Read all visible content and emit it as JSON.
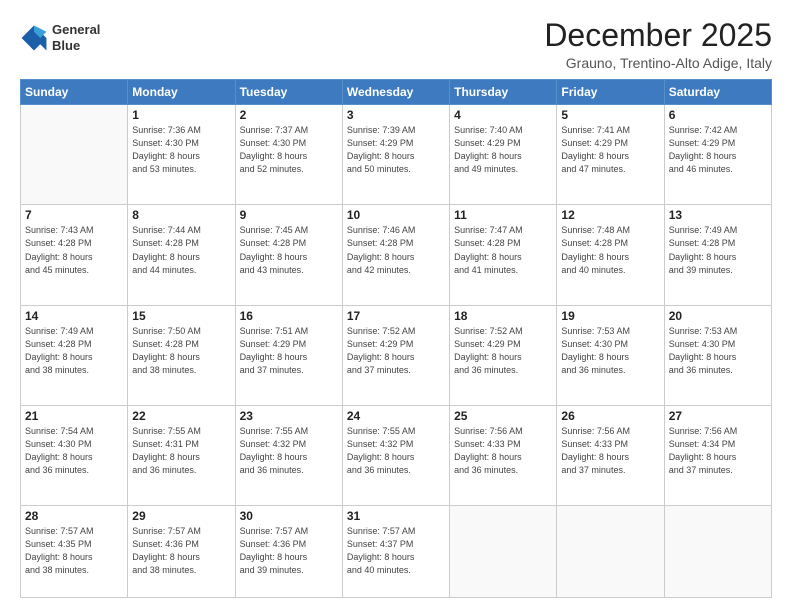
{
  "header": {
    "logo_line1": "General",
    "logo_line2": "Blue",
    "month": "December 2025",
    "location": "Grauno, Trentino-Alto Adige, Italy"
  },
  "weekdays": [
    "Sunday",
    "Monday",
    "Tuesday",
    "Wednesday",
    "Thursday",
    "Friday",
    "Saturday"
  ],
  "weeks": [
    [
      {
        "day": "",
        "info": ""
      },
      {
        "day": "1",
        "info": "Sunrise: 7:36 AM\nSunset: 4:30 PM\nDaylight: 8 hours\nand 53 minutes."
      },
      {
        "day": "2",
        "info": "Sunrise: 7:37 AM\nSunset: 4:30 PM\nDaylight: 8 hours\nand 52 minutes."
      },
      {
        "day": "3",
        "info": "Sunrise: 7:39 AM\nSunset: 4:29 PM\nDaylight: 8 hours\nand 50 minutes."
      },
      {
        "day": "4",
        "info": "Sunrise: 7:40 AM\nSunset: 4:29 PM\nDaylight: 8 hours\nand 49 minutes."
      },
      {
        "day": "5",
        "info": "Sunrise: 7:41 AM\nSunset: 4:29 PM\nDaylight: 8 hours\nand 47 minutes."
      },
      {
        "day": "6",
        "info": "Sunrise: 7:42 AM\nSunset: 4:29 PM\nDaylight: 8 hours\nand 46 minutes."
      }
    ],
    [
      {
        "day": "7",
        "info": "Sunrise: 7:43 AM\nSunset: 4:28 PM\nDaylight: 8 hours\nand 45 minutes."
      },
      {
        "day": "8",
        "info": "Sunrise: 7:44 AM\nSunset: 4:28 PM\nDaylight: 8 hours\nand 44 minutes."
      },
      {
        "day": "9",
        "info": "Sunrise: 7:45 AM\nSunset: 4:28 PM\nDaylight: 8 hours\nand 43 minutes."
      },
      {
        "day": "10",
        "info": "Sunrise: 7:46 AM\nSunset: 4:28 PM\nDaylight: 8 hours\nand 42 minutes."
      },
      {
        "day": "11",
        "info": "Sunrise: 7:47 AM\nSunset: 4:28 PM\nDaylight: 8 hours\nand 41 minutes."
      },
      {
        "day": "12",
        "info": "Sunrise: 7:48 AM\nSunset: 4:28 PM\nDaylight: 8 hours\nand 40 minutes."
      },
      {
        "day": "13",
        "info": "Sunrise: 7:49 AM\nSunset: 4:28 PM\nDaylight: 8 hours\nand 39 minutes."
      }
    ],
    [
      {
        "day": "14",
        "info": "Sunrise: 7:49 AM\nSunset: 4:28 PM\nDaylight: 8 hours\nand 38 minutes."
      },
      {
        "day": "15",
        "info": "Sunrise: 7:50 AM\nSunset: 4:28 PM\nDaylight: 8 hours\nand 38 minutes."
      },
      {
        "day": "16",
        "info": "Sunrise: 7:51 AM\nSunset: 4:29 PM\nDaylight: 8 hours\nand 37 minutes."
      },
      {
        "day": "17",
        "info": "Sunrise: 7:52 AM\nSunset: 4:29 PM\nDaylight: 8 hours\nand 37 minutes."
      },
      {
        "day": "18",
        "info": "Sunrise: 7:52 AM\nSunset: 4:29 PM\nDaylight: 8 hours\nand 36 minutes."
      },
      {
        "day": "19",
        "info": "Sunrise: 7:53 AM\nSunset: 4:30 PM\nDaylight: 8 hours\nand 36 minutes."
      },
      {
        "day": "20",
        "info": "Sunrise: 7:53 AM\nSunset: 4:30 PM\nDaylight: 8 hours\nand 36 minutes."
      }
    ],
    [
      {
        "day": "21",
        "info": "Sunrise: 7:54 AM\nSunset: 4:30 PM\nDaylight: 8 hours\nand 36 minutes."
      },
      {
        "day": "22",
        "info": "Sunrise: 7:55 AM\nSunset: 4:31 PM\nDaylight: 8 hours\nand 36 minutes."
      },
      {
        "day": "23",
        "info": "Sunrise: 7:55 AM\nSunset: 4:32 PM\nDaylight: 8 hours\nand 36 minutes."
      },
      {
        "day": "24",
        "info": "Sunrise: 7:55 AM\nSunset: 4:32 PM\nDaylight: 8 hours\nand 36 minutes."
      },
      {
        "day": "25",
        "info": "Sunrise: 7:56 AM\nSunset: 4:33 PM\nDaylight: 8 hours\nand 36 minutes."
      },
      {
        "day": "26",
        "info": "Sunrise: 7:56 AM\nSunset: 4:33 PM\nDaylight: 8 hours\nand 37 minutes."
      },
      {
        "day": "27",
        "info": "Sunrise: 7:56 AM\nSunset: 4:34 PM\nDaylight: 8 hours\nand 37 minutes."
      }
    ],
    [
      {
        "day": "28",
        "info": "Sunrise: 7:57 AM\nSunset: 4:35 PM\nDaylight: 8 hours\nand 38 minutes."
      },
      {
        "day": "29",
        "info": "Sunrise: 7:57 AM\nSunset: 4:36 PM\nDaylight: 8 hours\nand 38 minutes."
      },
      {
        "day": "30",
        "info": "Sunrise: 7:57 AM\nSunset: 4:36 PM\nDaylight: 8 hours\nand 39 minutes."
      },
      {
        "day": "31",
        "info": "Sunrise: 7:57 AM\nSunset: 4:37 PM\nDaylight: 8 hours\nand 40 minutes."
      },
      {
        "day": "",
        "info": ""
      },
      {
        "day": "",
        "info": ""
      },
      {
        "day": "",
        "info": ""
      }
    ]
  ]
}
